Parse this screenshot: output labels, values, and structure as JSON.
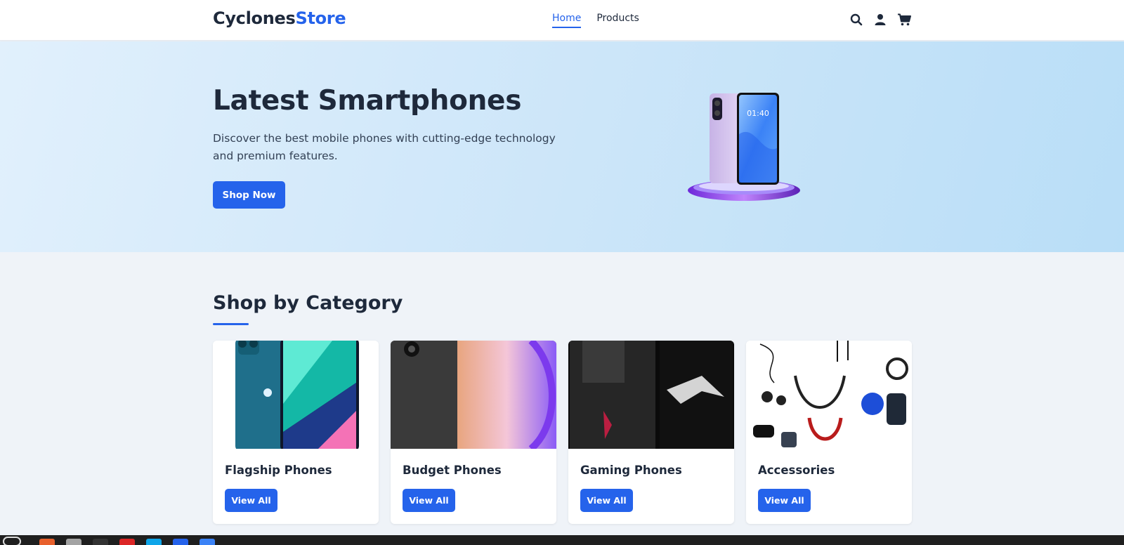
{
  "header": {
    "logo_part1": "Cyclones",
    "logo_part2": "Store",
    "nav": [
      {
        "label": "Home",
        "active": true
      },
      {
        "label": "Products",
        "active": false
      }
    ],
    "icons": [
      "search-icon",
      "user-icon",
      "cart-icon"
    ]
  },
  "hero": {
    "title": "Latest Smartphones",
    "description": "Discover the best mobile phones with cutting-edge technology and premium features.",
    "button_label": "Shop Now"
  },
  "categories": {
    "title": "Shop by Category",
    "items": [
      {
        "name": "Flagship Phones",
        "button": "View All"
      },
      {
        "name": "Budget Phones",
        "button": "View All"
      },
      {
        "name": "Gaming Phones",
        "button": "View All"
      },
      {
        "name": "Accessories",
        "button": "View All"
      }
    ]
  },
  "colors": {
    "accent": "#2563eb",
    "text_dark": "#1e293b",
    "page_bg": "#eff3f8",
    "hero_bg": "#cde6f9"
  }
}
